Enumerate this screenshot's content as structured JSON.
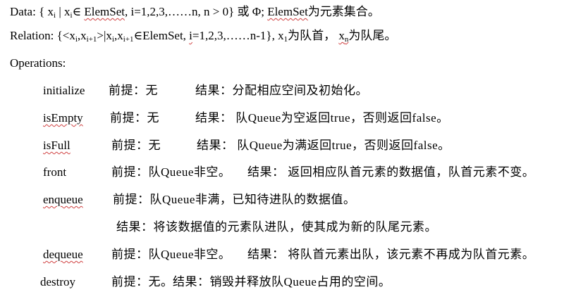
{
  "data_line": {
    "label": "Data:",
    "set_open": "{ x",
    "sub_i": "i",
    "bar": " | x",
    "elem": "∈ ",
    "elemset1": "ElemSet",
    "range": ", i=1,2,3,……n, n > 0} 或 Φ; ",
    "elemset2": "ElemSet",
    "tail": "为元素集合。"
  },
  "relation_line": {
    "label": "Relation:",
    "open": " {<x",
    "sub_i": "i",
    "comma": ",x",
    "sub_i1": "i+1",
    "bar": ">|x",
    "comma2": ",x",
    "elem": "∈ElemSet, ",
    "i_var": "i",
    "range": "=1,2,3,……n-1}, x",
    "sub_1": "1",
    "head_txt": "为队首，",
    "xn": "x",
    "sub_n": "n",
    "tail_txt": "为队尾。"
  },
  "operations_label": "Operations:",
  "operations": [
    {
      "name": "initialize",
      "pre": "前提：无",
      "result": "结果：分配相应空间及初始化。"
    },
    {
      "name": "isEmpty",
      "pre": "前提：无",
      "result": "结果：   队Queue为空返回true，否则返回false。"
    },
    {
      "name": "isFull",
      "pre": "前提：无",
      "result": "结果：   队Queue为满返回true，否则返回false。"
    },
    {
      "name": "front",
      "pre": "前提：队Queue非空。",
      "result": "结果：   返回相应队首元素的数据值，队首元素不变。"
    },
    {
      "name": "enqueue",
      "pre": "前提：队Queue非满，已知待进队的数据值。",
      "result": ""
    },
    {
      "name": "",
      "pre": "",
      "result": "结果：将该数据值的元素队进队，使其成为新的队尾元素。"
    },
    {
      "name": "dequeue",
      "pre": "前提：队Queue非空。",
      "result": "结果：   将队首元素出队，该元素不再成为队首元素。"
    },
    {
      "name": "destroy",
      "pre": "前提：无。",
      "result": "结果：销毁并释放队Queue占用的空间。"
    }
  ]
}
